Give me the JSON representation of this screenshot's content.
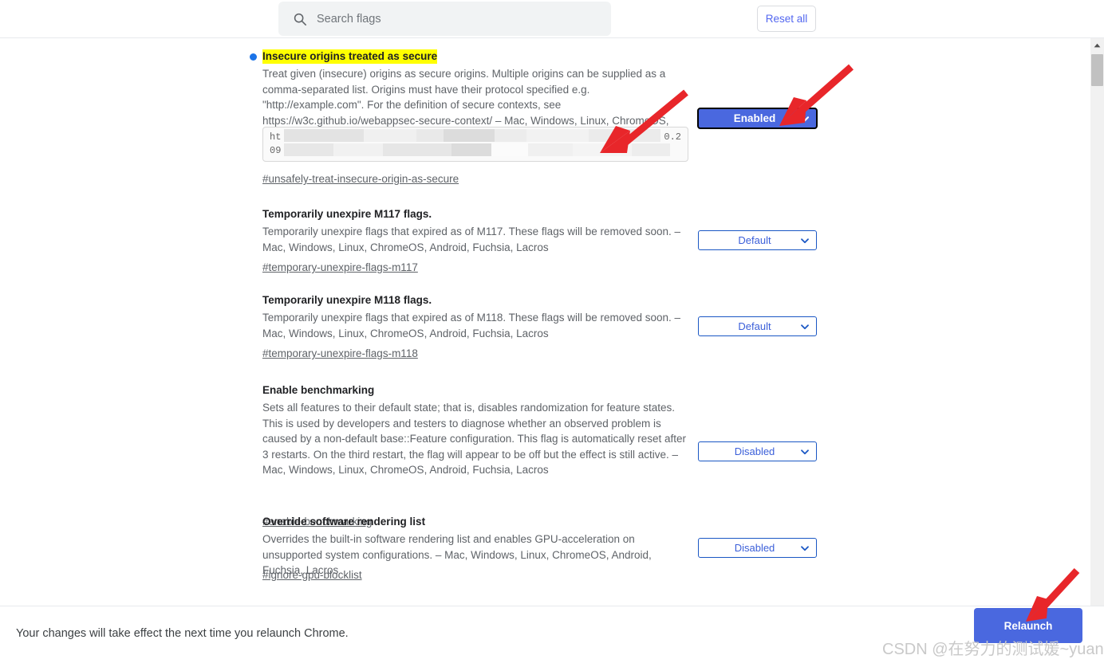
{
  "search": {
    "placeholder": "Search flags",
    "value": "",
    "icon": "search-icon"
  },
  "toolbar": {
    "reset_all_label": "Reset all"
  },
  "colors": {
    "accent_blue": "#4a68df",
    "link_blue": "#5367f0",
    "select_border": "#1a57c4",
    "highlight_yellow": "#ffff00",
    "bullet_blue": "#1a73e8",
    "annotation_red": "#e8262a",
    "search_bg": "#f1f3f4",
    "text_primary": "#202124",
    "text_secondary": "#5f6368"
  },
  "flags": [
    {
      "title": "Insecure origins treated as secure",
      "highlighted": true,
      "has_bullet": true,
      "description": "Treat given (insecure) origins as secure origins. Multiple origins can be supplied as a comma-separated list. Origins must have their protocol specified e.g. \"http://example.com\". For the definition of secure contexts, see https://w3c.github.io/webappsec-secure-context/ – Mac, Windows, Linux, ChromeOS, Android, Fuchsia, Lacros",
      "permalink": "#unsafely-treat-insecure-origin-as-secure",
      "select_value": "Enabled",
      "select_state": "enabled",
      "origin_input": {
        "visible_prefix_line1": "ht",
        "visible_prefix_line2": "09",
        "visible_suffix": "0.2",
        "redacted": true
      }
    },
    {
      "title": "Temporarily unexpire M117 flags.",
      "highlighted": false,
      "has_bullet": false,
      "description": "Temporarily unexpire flags that expired as of M117. These flags will be removed soon. – Mac, Windows, Linux, ChromeOS, Android, Fuchsia, Lacros",
      "permalink": "#temporary-unexpire-flags-m117",
      "select_value": "Default",
      "select_state": "default"
    },
    {
      "title": "Temporarily unexpire M118 flags.",
      "highlighted": false,
      "has_bullet": false,
      "description": "Temporarily unexpire flags that expired as of M118. These flags will be removed soon. – Mac, Windows, Linux, ChromeOS, Android, Fuchsia, Lacros",
      "permalink": "#temporary-unexpire-flags-m118",
      "select_value": "Default",
      "select_state": "default"
    },
    {
      "title": "Enable benchmarking",
      "highlighted": false,
      "has_bullet": false,
      "description": "Sets all features to their default state; that is, disables randomization for feature states. This is used by developers and testers to diagnose whether an observed problem is caused by a non-default base::Feature configuration. This flag is automatically reset after 3 restarts. On the third restart, the flag will appear to be off but the effect is still active. – Mac, Windows, Linux, ChromeOS, Android, Fuchsia, Lacros",
      "permalink": "#enable-benchmarking",
      "select_value": "Disabled",
      "select_state": "default"
    },
    {
      "title": "Override software rendering list",
      "highlighted": false,
      "has_bullet": false,
      "description": "Overrides the built-in software rendering list and enables GPU-acceleration on unsupported system configurations. – Mac, Windows, Linux, ChromeOS, Android, Fuchsia, Lacros",
      "permalink": "#ignore-gpu-blocklist",
      "select_value": "Disabled",
      "select_state": "default"
    }
  ],
  "bottom_bar": {
    "note": "Your changes will take effect the next time you relaunch Chrome.",
    "relaunch_label": "Relaunch"
  },
  "watermark": {
    "text": "CSDN @在努力的测试媛~yuan"
  },
  "select_options": [
    "Default",
    "Enabled",
    "Disabled"
  ]
}
